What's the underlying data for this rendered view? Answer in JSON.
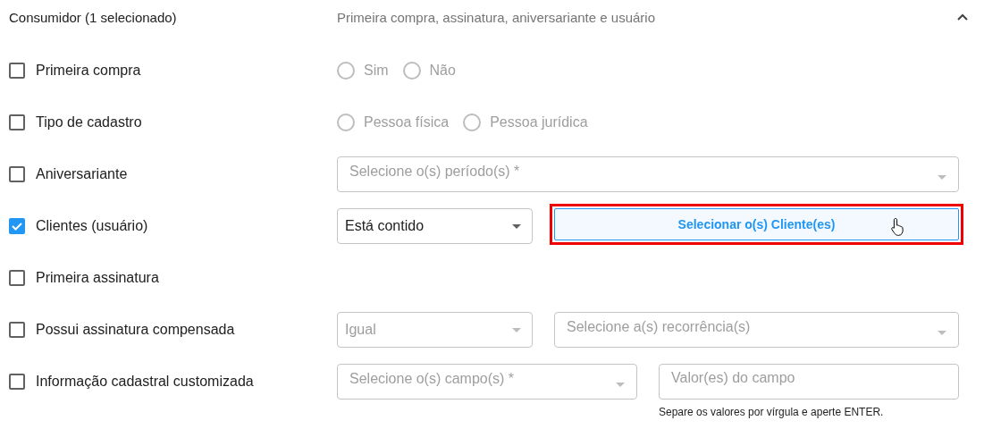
{
  "header": {
    "title": "Consumidor (1 selecionado)",
    "summary": "Primeira compra, assinatura, aniversariante e usuário",
    "expanded": true
  },
  "rows": [
    {
      "kind": "radios",
      "label": "Primeira compra",
      "checked": false,
      "options": [
        {
          "label": "Sim",
          "selected": false
        },
        {
          "label": "Não",
          "selected": false
        }
      ]
    },
    {
      "kind": "radios",
      "label": "Tipo de cadastro",
      "checked": false,
      "options": [
        {
          "label": "Pessoa física",
          "selected": false
        },
        {
          "label": "Pessoa jurídica",
          "selected": false
        }
      ]
    },
    {
      "kind": "dropdown",
      "label": "Aniversariante",
      "checked": false,
      "dropdown": {
        "placeholder": "Selecione o(s) período(s) *"
      }
    },
    {
      "kind": "dropdown-button",
      "label": "Clientes (usuário)",
      "checked": true,
      "dropdown": {
        "value": "Está contido"
      },
      "button": {
        "label": "Selecionar o(s) Cliente(es)",
        "highlighted": true
      }
    },
    {
      "kind": "blank",
      "label": "Primeira assinatura",
      "checked": false
    },
    {
      "kind": "dropdown-pair",
      "label": "Possui assinatura compensada",
      "checked": false,
      "dropdowns": [
        {
          "value": "Igual",
          "disabled": true
        },
        {
          "placeholder": "Selecione a(s) recorrência(s)"
        }
      ]
    },
    {
      "kind": "dropdown-input",
      "label": "Informação cadastral customizada",
      "checked": false,
      "dropdown": {
        "placeholder": "Selecione o(s) campo(s) *"
      },
      "input": {
        "placeholder": "Valor(es) do campo",
        "helper": "Separe os valores por vírgula e aperte ENTER."
      }
    }
  ]
}
